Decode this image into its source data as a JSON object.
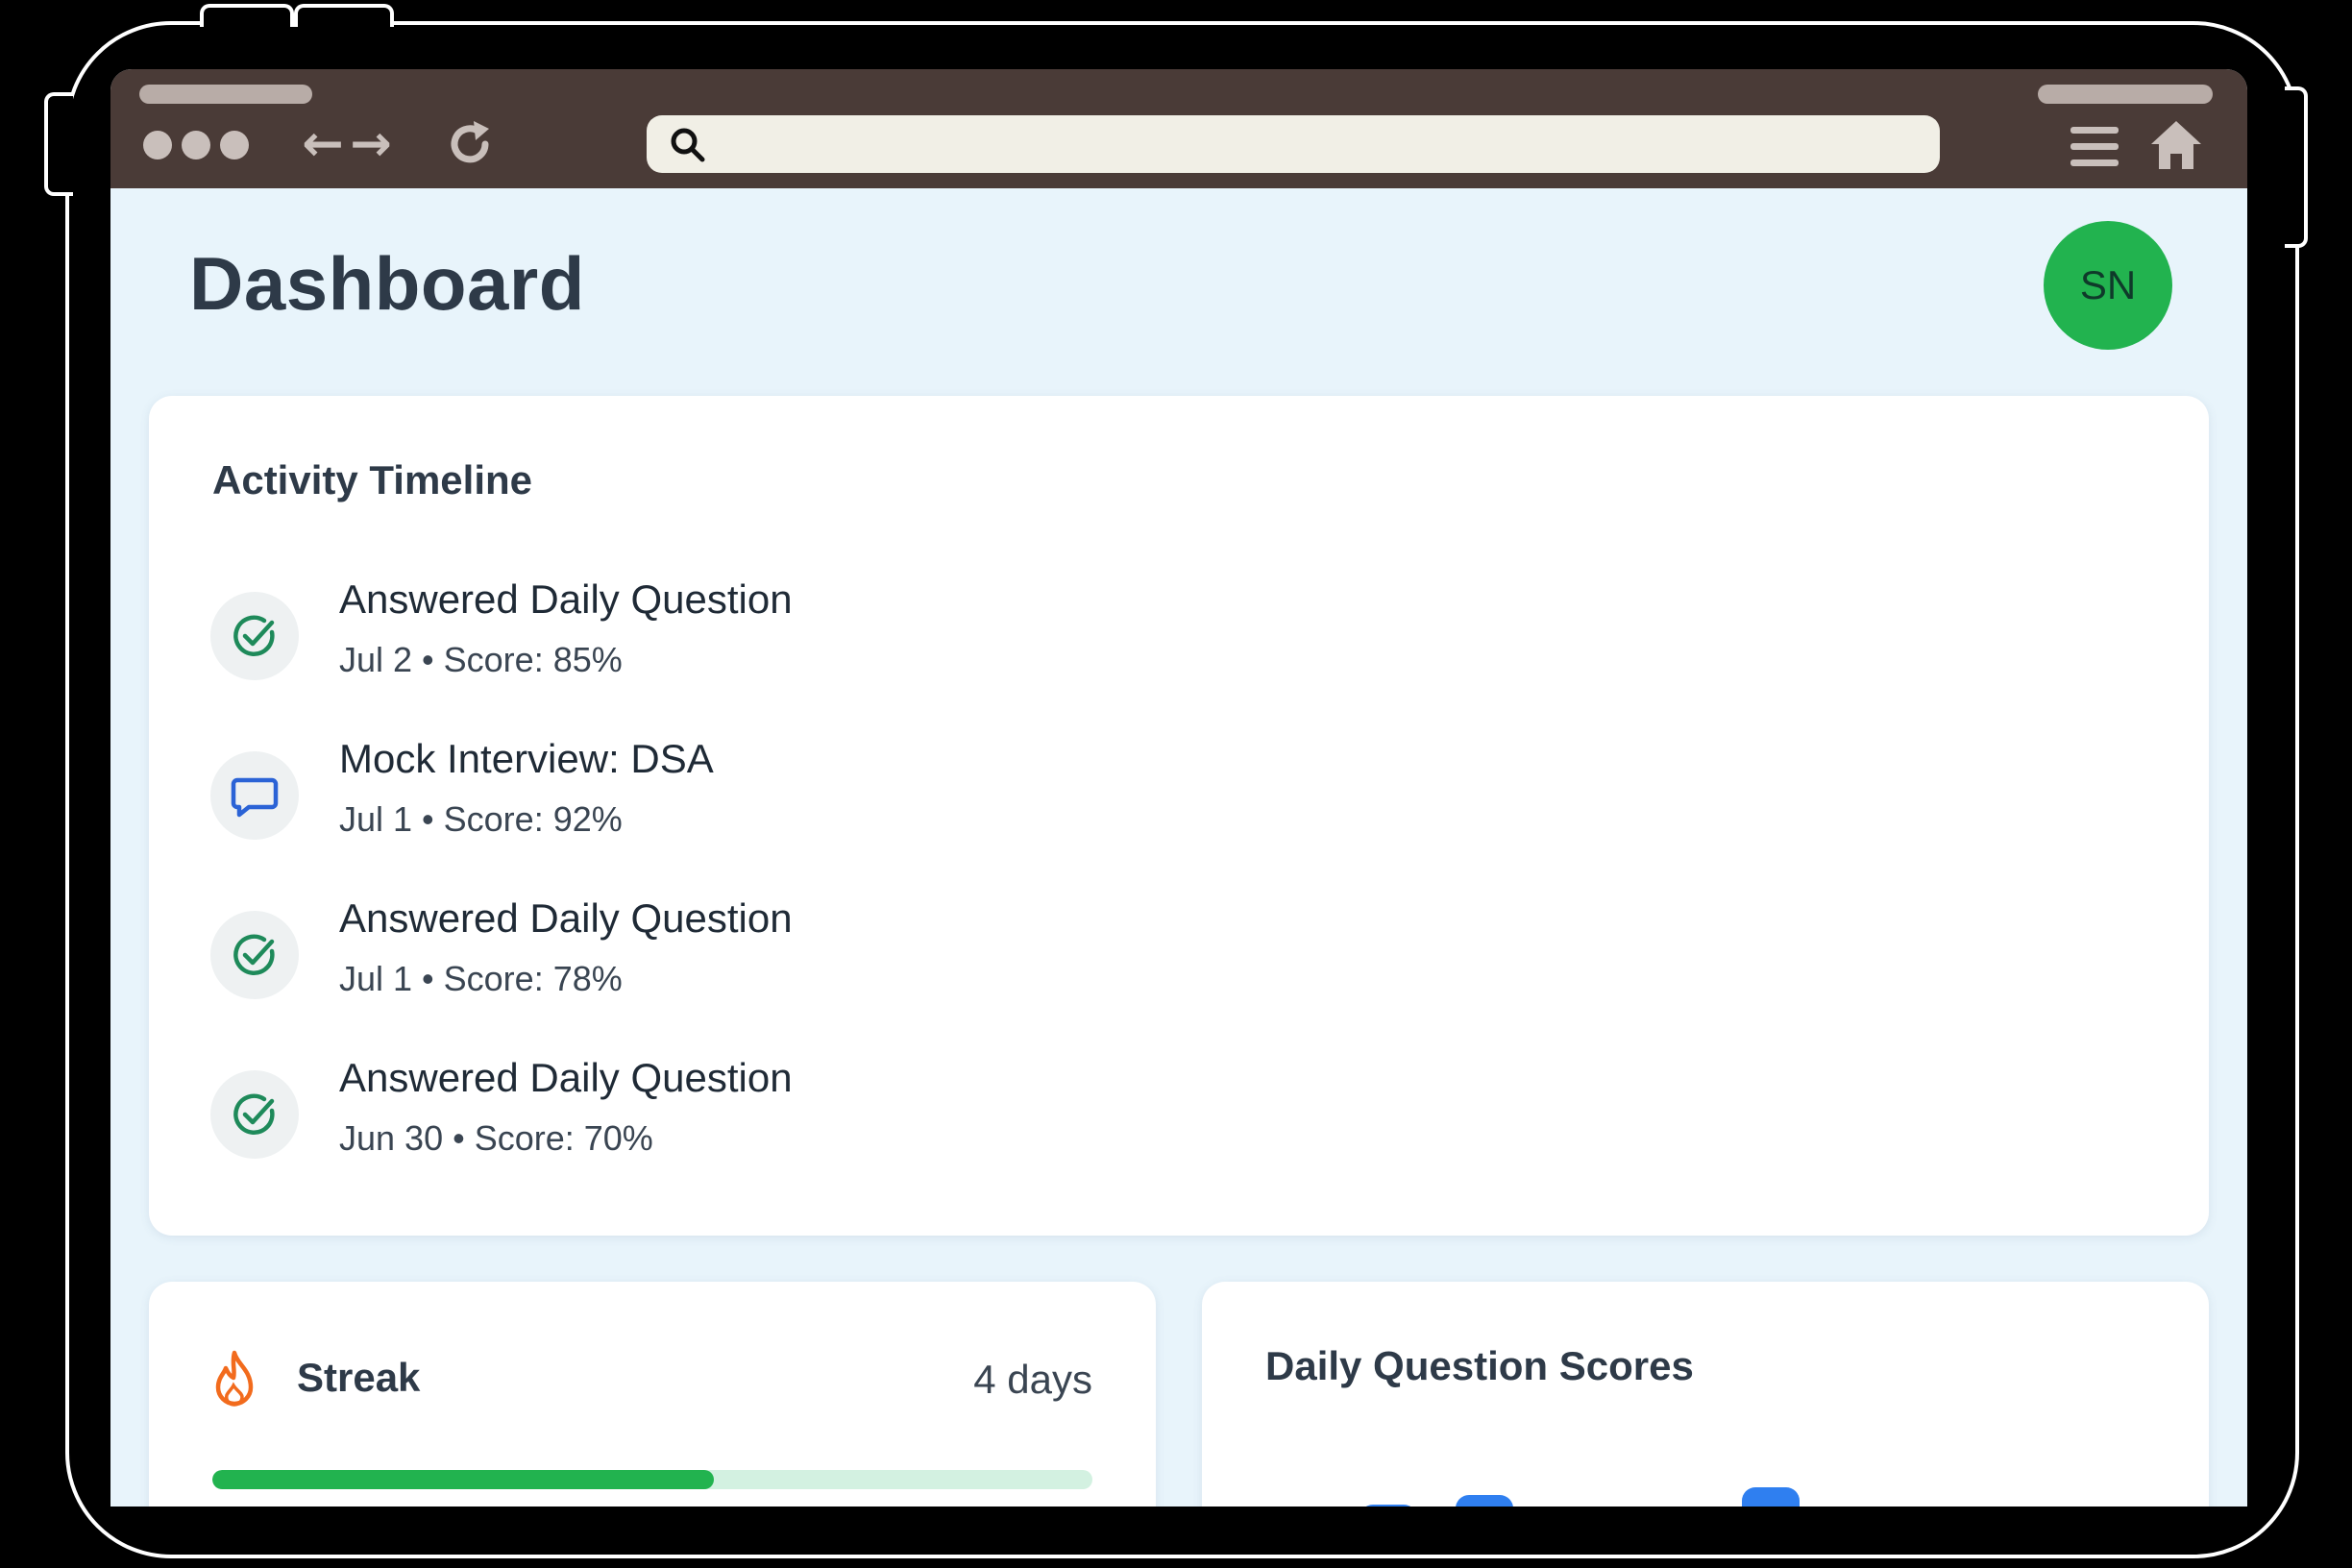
{
  "browser": {
    "url_value": "",
    "icons": {
      "window_dots": "window-controls-icon",
      "back": "back-arrow-icon",
      "forward": "forward-arrow-icon",
      "reload": "reload-icon",
      "search": "search-icon",
      "menu": "menu-icon",
      "home": "home-icon"
    }
  },
  "header": {
    "title": "Dashboard",
    "avatar_initials": "SN",
    "avatar_color": "#22b34f"
  },
  "timeline": {
    "title": "Activity Timeline",
    "items": [
      {
        "icon": "check-circle-icon",
        "title": "Answered Daily Question",
        "meta": "Jul 2 • Score: 85%"
      },
      {
        "icon": "chat-bubble-icon",
        "title": "Mock Interview: DSA",
        "meta": "Jul 1 • Score: 92%"
      },
      {
        "icon": "check-circle-icon",
        "title": "Answered Daily Question",
        "meta": "Jul 1 • Score: 78%"
      },
      {
        "icon": "check-circle-icon",
        "title": "Answered Daily Question",
        "meta": "Jun 30 • Score: 70%"
      }
    ]
  },
  "streak": {
    "title": "Streak",
    "value": "4 days",
    "progress_fraction": 0.57,
    "icon": "flame-icon",
    "bar_color": "#22b34f",
    "track_color": "#d3f1e1"
  },
  "scores": {
    "title": "Daily Question Scores",
    "bar_color": "#2f7ff0"
  }
}
